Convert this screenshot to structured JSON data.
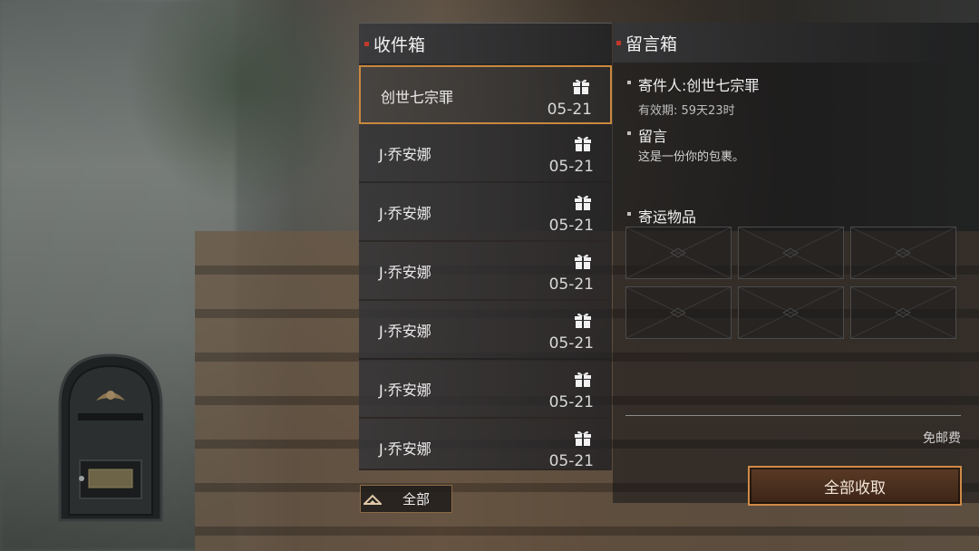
{
  "inbox": {
    "title": "收件箱",
    "mails": [
      {
        "sender": "创世七宗罪",
        "date": "05-21",
        "icon": "gift-icon",
        "selected": true
      },
      {
        "sender": "J·乔安娜",
        "date": "05-21",
        "icon": "gift-icon",
        "selected": false
      },
      {
        "sender": "J·乔安娜",
        "date": "05-21",
        "icon": "gift-icon",
        "selected": false
      },
      {
        "sender": "J·乔安娜",
        "date": "05-21",
        "icon": "gift-icon",
        "selected": false
      },
      {
        "sender": "J·乔安娜",
        "date": "05-21",
        "icon": "gift-icon",
        "selected": false
      },
      {
        "sender": "J·乔安娜",
        "date": "05-21",
        "icon": "gift-icon",
        "selected": false
      },
      {
        "sender": "J·乔安娜",
        "date": "05-21",
        "icon": "gift-icon",
        "selected": false
      }
    ],
    "filter_button": "全部"
  },
  "message": {
    "title": "留言箱",
    "sender_line": "寄件人:创世七宗罪",
    "validity": "有效期: 59天23时",
    "message_label": "留言",
    "message_body": "这是一份你的包裹。",
    "items_label": "寄运物品",
    "item_slots": 6,
    "postage": "免邮费",
    "collect_all": "全部收取"
  },
  "colors": {
    "accent_orange": "#c8883e",
    "header_dot": "#c0392b",
    "button_fill": "#4a2e1e"
  }
}
